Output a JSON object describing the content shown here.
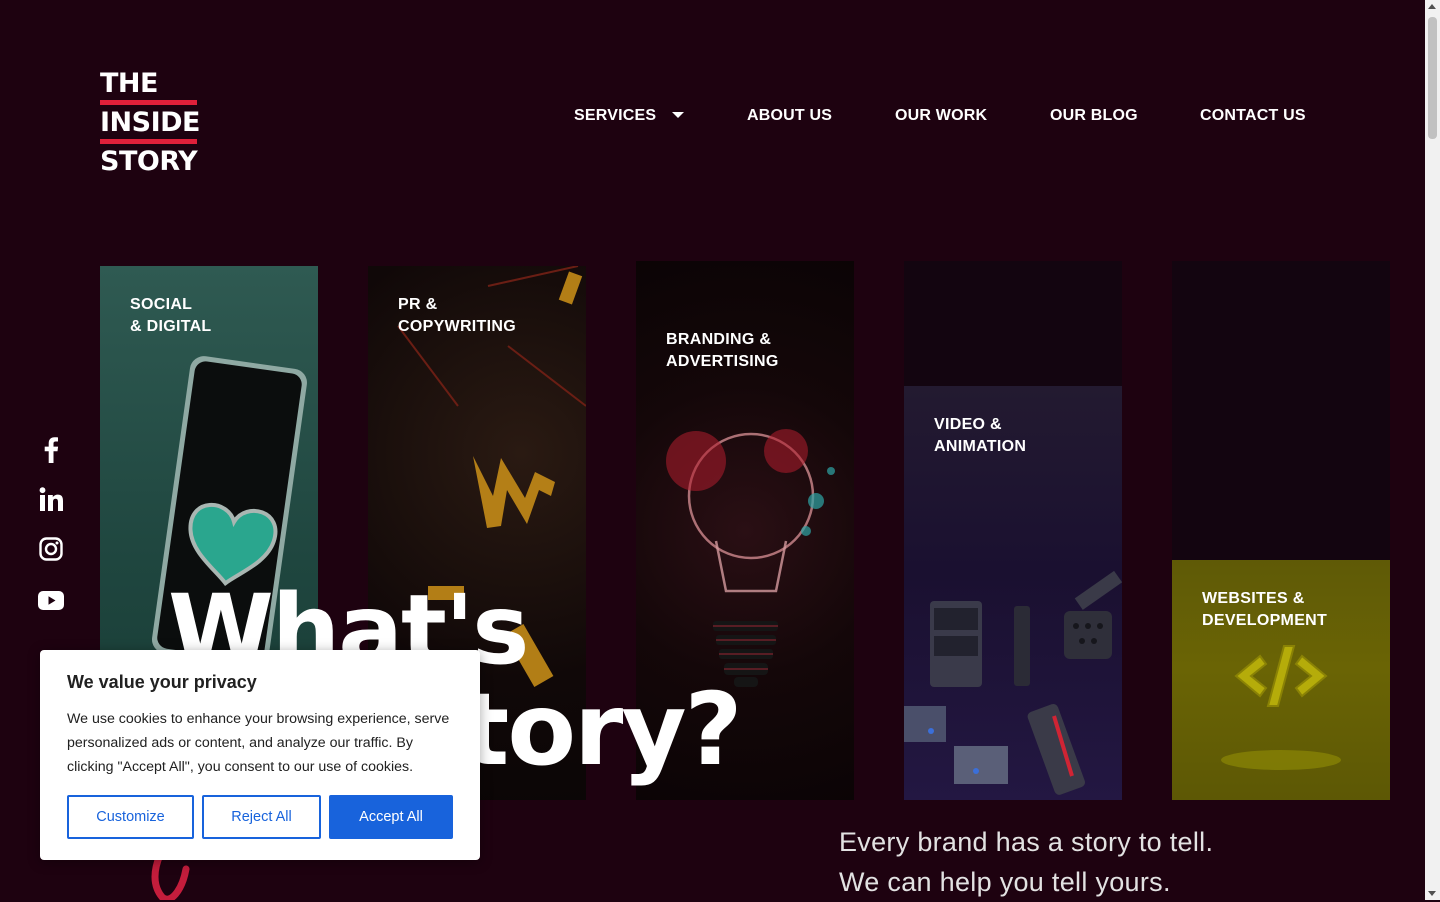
{
  "logo": {
    "line1": "THE",
    "line2": "INSIDE",
    "line3": "STORY",
    "accent": "#e0203a"
  },
  "nav": {
    "items": [
      {
        "label": "SERVICES",
        "has_dropdown": true
      },
      {
        "label": "ABOUT US"
      },
      {
        "label": "OUR WORK"
      },
      {
        "label": "OUR BLOG"
      },
      {
        "label": "CONTACT US"
      }
    ]
  },
  "social": [
    "facebook-icon",
    "linkedin-icon",
    "instagram-icon",
    "youtube-icon"
  ],
  "services": [
    {
      "line1": "SOCIAL",
      "line2": "& DIGITAL"
    },
    {
      "line1": "PR &",
      "line2": "COPYWRITING"
    },
    {
      "line1": "BRANDING &",
      "line2": "ADVERTISING"
    },
    {
      "line1": "VIDEO &",
      "line2": "ANIMATION"
    },
    {
      "line1": "WEBSITES &",
      "line2": "DEVELOPMENT"
    }
  ],
  "hero": {
    "headline_line1": "What's",
    "headline_line2": "story?"
  },
  "tagline": {
    "line1": "Every brand has a story to tell.",
    "line2": "We can help you tell yours."
  },
  "cookie": {
    "title": "We value your privacy",
    "body": "We use cookies to enhance your browsing experience, serve personalized ads or content, and analyze our traffic. By clicking \"Accept All\", you consent to our use of cookies.",
    "customize": "Customize",
    "reject": "Reject All",
    "accept": "Accept All",
    "button_color": "#1863dc"
  },
  "colors": {
    "background": "#1e0210",
    "accent": "#e0203a"
  }
}
